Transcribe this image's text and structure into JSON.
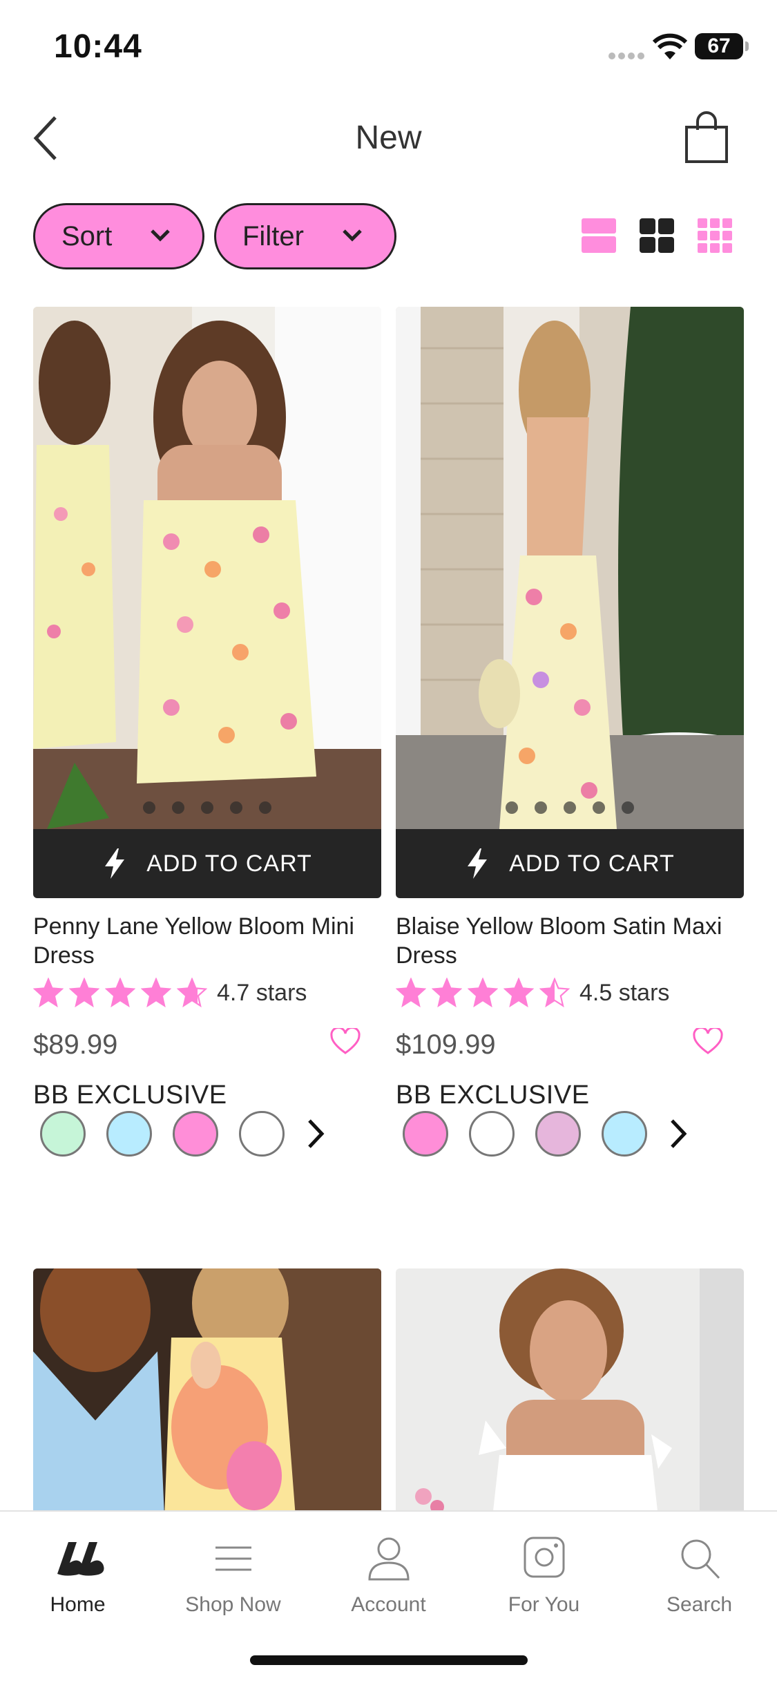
{
  "status": {
    "time": "10:44",
    "battery": "67"
  },
  "nav": {
    "title": "New"
  },
  "filters": {
    "sort_label": "Sort",
    "filter_label": "Filter"
  },
  "colors": {
    "accent_pink": "#ff8ddd",
    "dark": "#252525",
    "star_pink": "#ff7fd6"
  },
  "products": [
    {
      "name": "Penny Lane Yellow Bloom Mini Dress",
      "cart_label": "ADD TO CART",
      "rating": 4.7,
      "rating_label": "4.7 stars",
      "price": "$89.99",
      "badge": "BB EXCLUSIVE",
      "swatches": [
        "#c6f5d8",
        "#b8ecff",
        "#ff8ed8",
        "#ffffff"
      ]
    },
    {
      "name": "Blaise Yellow Bloom Satin Maxi Dress",
      "cart_label": "ADD TO CART",
      "rating": 4.5,
      "rating_label": "4.5 stars",
      "price": "$109.99",
      "badge": "BB EXCLUSIVE",
      "swatches": [
        "#ff8ed8",
        "#ffffff",
        "#e6b6dc",
        "#b8ecff"
      ]
    }
  ],
  "tabs": [
    {
      "label": "Home",
      "icon": "brand-logo-icon",
      "active": true
    },
    {
      "label": "Shop Now",
      "icon": "menu-icon"
    },
    {
      "label": "Account",
      "icon": "user-icon"
    },
    {
      "label": "For You",
      "icon": "instagram-icon"
    },
    {
      "label": "Search",
      "icon": "search-icon"
    }
  ]
}
